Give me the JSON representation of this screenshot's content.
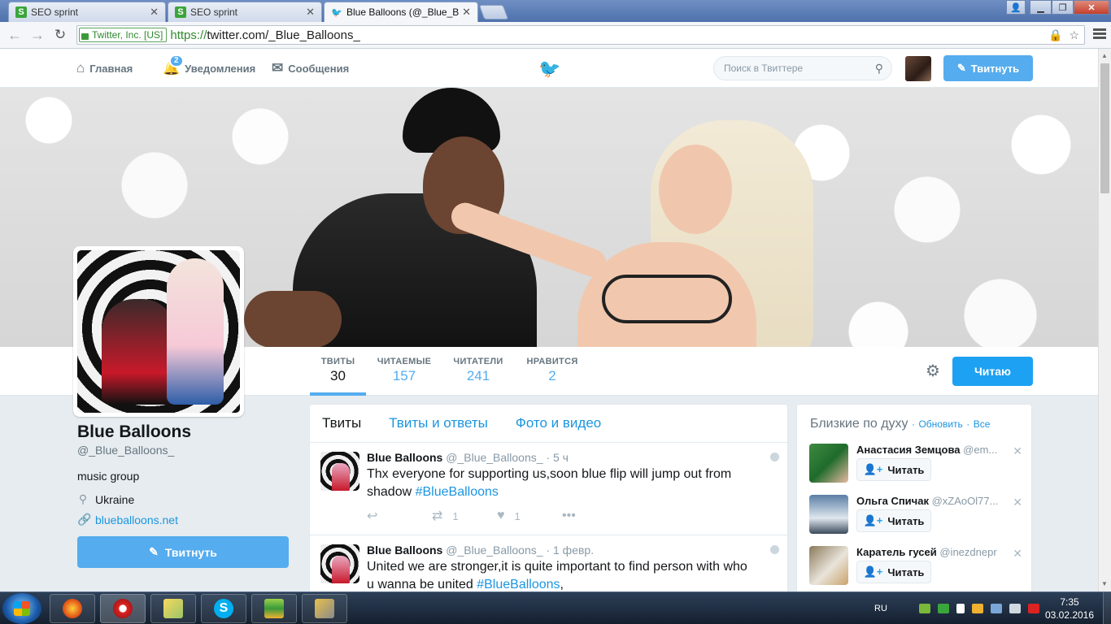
{
  "browser": {
    "tabs": [
      {
        "title": "SEO sprint",
        "favicon": "seosprint-icon",
        "active": false
      },
      {
        "title": "SEO sprint",
        "favicon": "seosprint-icon",
        "active": false
      },
      {
        "title": "Blue Balloons (@_Blue_Bal",
        "favicon": "twitter-bird-icon",
        "active": true
      }
    ],
    "ev_label": "Twitter, Inc. [US]",
    "url_protocol": "https://",
    "url_rest": "twitter.com/_Blue_Balloons_"
  },
  "nav": {
    "home": "Главная",
    "notifications": "Уведомления",
    "notifications_count": "2",
    "messages": "Сообщения",
    "search_placeholder": "Поиск в Твиттере",
    "tweet_button": "Твитнуть"
  },
  "profile": {
    "stats": [
      {
        "label": "ТВИТЫ",
        "value": "30"
      },
      {
        "label": "ЧИТАЕМЫЕ",
        "value": "157"
      },
      {
        "label": "ЧИТАТЕЛИ",
        "value": "241"
      },
      {
        "label": "НРАВИТСЯ",
        "value": "2"
      }
    ],
    "follow_button": "Читаю",
    "name": "Blue Balloons",
    "handle": "@_Blue_Balloons_",
    "bio": "music group",
    "location": "Ukraine",
    "website": "blueballoons.net",
    "tweet_button": "Твитнуть"
  },
  "timeline": {
    "tabs": [
      "Твиты",
      "Твиты и ответы",
      "Фото и видео"
    ],
    "tweets": [
      {
        "name": "Blue Balloons",
        "handle": "@_Blue_Balloons_",
        "sep": "·",
        "time": "5 ч",
        "text": "Thx everyone for supporting us,soon blue flip will jump out from shadow ",
        "hashtag": "#BlueBalloons",
        "retweets": "1",
        "likes": "1"
      },
      {
        "name": "Blue Balloons",
        "handle": "@_Blue_Balloons_",
        "sep": "·",
        "time": "1 февр.",
        "text": "United we are stronger,it is quite important to find person with who u wanna be united ",
        "hashtag": "#BlueBalloons",
        "trail": ","
      }
    ]
  },
  "who_to_follow": {
    "title": "Близкие по духу",
    "sep": "·",
    "refresh": "Обновить",
    "all": "Все",
    "follow_label": "Читать",
    "users": [
      {
        "name": "Анастасия Земцова",
        "handle": "@em..."
      },
      {
        "name": "Ольга Спичак",
        "handle": "@xZAoOl77..."
      },
      {
        "name": "Каратель гусей",
        "handle": "@inezdnepr"
      }
    ]
  },
  "taskbar": {
    "lang": "RU",
    "time": "7:35",
    "date": "03.02.2016"
  },
  "colors": {
    "twitter_blue": "#55acee",
    "follow_blue": "#1da1f2",
    "link_blue": "#1b95e0"
  }
}
